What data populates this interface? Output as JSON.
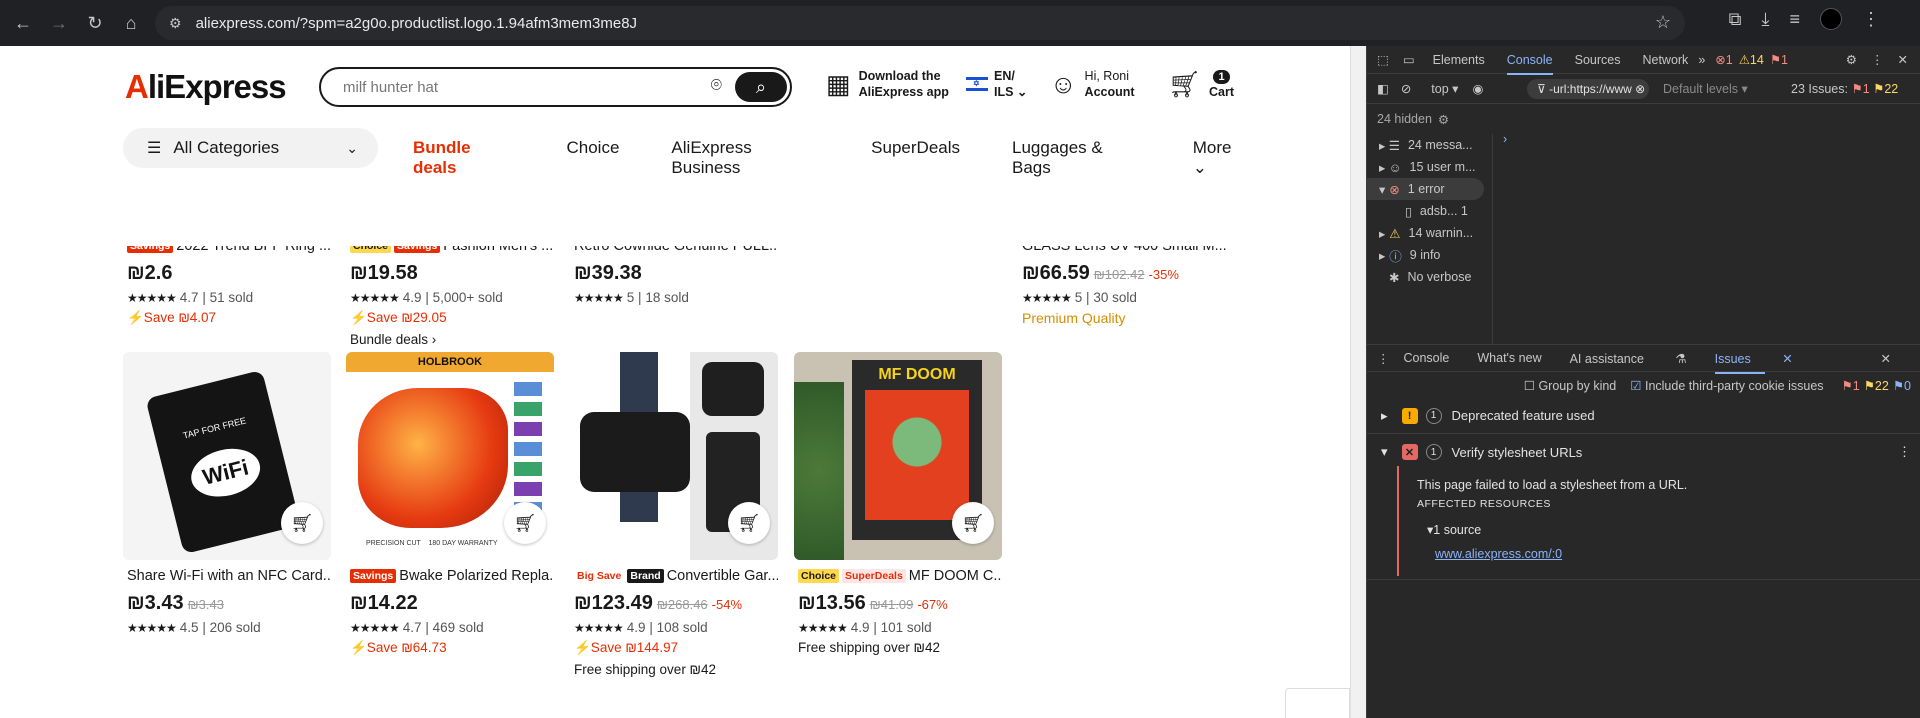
{
  "browser": {
    "url": "aliexpress.com/?spm=a2g0o.productlist.logo.1.94afm3mem3me8J"
  },
  "header": {
    "logo_prefix": "A",
    "logo_rest": "liExpress",
    "search_placeholder": "milf hunter hat",
    "download_line1": "Download the",
    "download_line2": "AliExpress app",
    "lang_line1": "EN/",
    "lang_line2": "ILS",
    "account_line1": "Hi, Roni",
    "account_line2": "Account",
    "cart_count": "1",
    "cart_label": "Cart",
    "categories_label": "All Categories",
    "nav": [
      "Bundle deals",
      "Choice",
      "AliExpress Business",
      "SuperDeals",
      "Luggages & Bags",
      "More"
    ]
  },
  "products_top": [
    {
      "tags": [
        "Savings"
      ],
      "title": "2022 Trend BFF Ring ...",
      "price": "₪2.6",
      "old": "",
      "disc": "",
      "rating": "4.7",
      "sold": "51 sold",
      "save": "Save ₪4.07",
      "extra": ""
    },
    {
      "tags": [
        "Choice",
        "Savings"
      ],
      "title": "Fashion Men's ...",
      "price": "₪19.58",
      "old": "",
      "disc": "",
      "rating": "4.9",
      "sold": "5,000+ sold",
      "save": "Save ₪29.05",
      "extra": "Bundle deals ›"
    },
    {
      "tags": [],
      "title": "Retro Cowhide Genuine PULL...",
      "price": "₪39.38",
      "old": "",
      "disc": "",
      "rating": "5",
      "sold": "18 sold",
      "save": "",
      "extra": ""
    },
    {
      "tags": [],
      "title": "GLASS Lens UV 400 Small M...",
      "price": "₪66.59",
      "old": "₪102.42",
      "disc": "-35%",
      "rating": "5",
      "sold": "30 sold",
      "save": "",
      "extra": "Premium Quality"
    }
  ],
  "products_bottom": [
    {
      "tags": [],
      "title": "Share Wi-Fi with an NFC Card...",
      "price": "₪3.43",
      "old": "₪3.43",
      "disc": "",
      "rating": "4.5",
      "sold": "206 sold",
      "save": "",
      "extra": ""
    },
    {
      "tags": [
        "Savings"
      ],
      "title": "Bwake Polarized Repla...",
      "price": "₪14.22",
      "old": "",
      "disc": "",
      "rating": "4.7",
      "sold": "469 sold",
      "save": "Save ₪64.73",
      "extra": ""
    },
    {
      "tags": [
        "Big Save",
        "Brand"
      ],
      "title": "Convertible Gar...",
      "price": "₪123.49",
      "old": "₪268.46",
      "disc": "-54%",
      "rating": "4.9",
      "sold": "108 sold",
      "save": "Save ₪144.97",
      "extra": "Free shipping over ₪42"
    },
    {
      "tags": [
        "Choice",
        "SuperDeals"
      ],
      "title": "MF DOOM C...",
      "price": "₪13.56",
      "old": "₪41.09",
      "disc": "-67%",
      "rating": "4.9",
      "sold": "101 sold",
      "save": "",
      "extra": "Free shipping over ₪42"
    }
  ],
  "card_texts": {
    "wifi_card_top": "TAP FOR FREE",
    "wifi_card_logo": "WiFi",
    "holbrook": "HOLBROOK",
    "precision": "PRECISION CUT",
    "warranty": "180 DAY WARRANTY",
    "mfdoom": "MF DOOM"
  },
  "devtools": {
    "tabs": [
      "Elements",
      "Console",
      "Sources",
      "Network"
    ],
    "err_count": "1",
    "warn_count": "14",
    "issue_count": "1",
    "context": "top",
    "filter": "-url:https://www",
    "levels": "Default levels",
    "issues_summary": "23 Issues:",
    "issues_err": "1",
    "issues_warn": "22",
    "hidden": "24 hidden",
    "sidebar": [
      "24 messa...",
      "15 user m...",
      "1 error",
      "adsb...  1",
      "14 warnin...",
      "9 info",
      "No verbose"
    ],
    "drawer_tabs": [
      "Console",
      "What's new",
      "AI assistance",
      "Issues"
    ],
    "group_by_kind": "Group by kind",
    "third_party": "Include third-party cookie issues",
    "bar_err": "1",
    "bar_warn": "22",
    "bar_info": "0",
    "issue1": "Deprecated feature used",
    "issue2": "Verify stylesheet URLs",
    "issue_count_each": "1",
    "detail_text": "This page failed to load a stylesheet from a URL.",
    "affected": "AFFECTED RESOURCES",
    "sources": "1 source",
    "link": "www.aliexpress.com/:0"
  },
  "colors": {
    "accent_red": "#e62e04",
    "devtools_blue": "#8ab4f8"
  }
}
